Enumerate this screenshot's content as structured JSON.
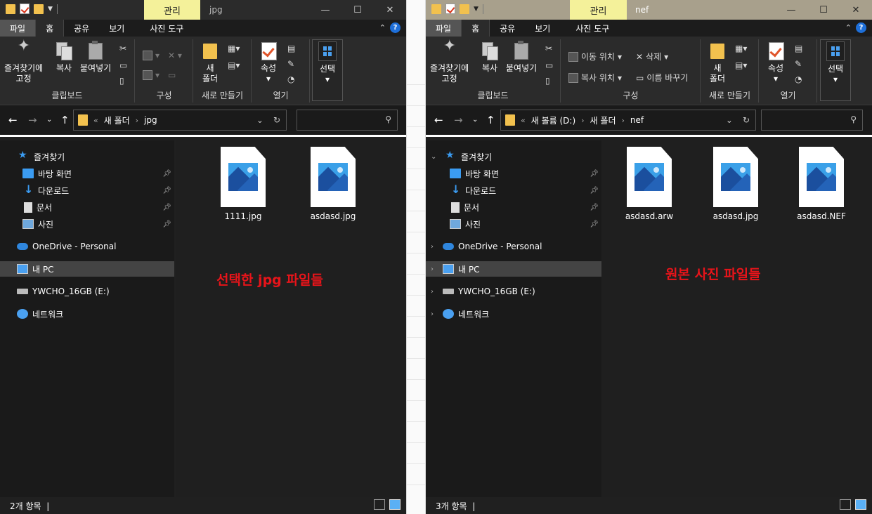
{
  "left": {
    "manage_tab": "관리",
    "title": "jpg",
    "ribbon_tabs": [
      "파일",
      "홈",
      "공유",
      "보기",
      "사진 도구"
    ],
    "ribbon": {
      "pin_label_1": "즐겨찾기에",
      "pin_label_2": "고정",
      "copy": "복사",
      "paste": "붙여넣기",
      "clipboard": "클립보드",
      "organize": "구성",
      "new_folder_1": "새",
      "new_folder_2": "폴더",
      "new_group": "새로 만들기",
      "properties": "속성",
      "open_group": "열기",
      "select": "선택"
    },
    "address": {
      "prefix": "«",
      "path": [
        "새 폴더",
        "jpg"
      ]
    },
    "nav": {
      "quick_access": "즐겨찾기",
      "desktop": "바탕 화면",
      "downloads": "다운로드",
      "documents": "문서",
      "pictures": "사진",
      "onedrive": "OneDrive - Personal",
      "this_pc": "내 PC",
      "usb": "YWCHO_16GB (E:)",
      "network": "네트워크"
    },
    "files": [
      "1111.jpg",
      "asdasd.jpg"
    ],
    "annotation": "선택한 jpg 파일들",
    "status": "2개 항목"
  },
  "right": {
    "manage_tab": "관리",
    "title": "nef",
    "ribbon_tabs": [
      "파일",
      "홈",
      "공유",
      "보기",
      "사진 도구"
    ],
    "ribbon": {
      "pin_label_1": "즐겨찾기에",
      "pin_label_2": "고정",
      "copy": "복사",
      "paste": "붙여넣기",
      "clipboard": "클립보드",
      "move_to": "이동 위치",
      "copy_to": "복사 위치",
      "delete": "삭제",
      "rename": "이름 바꾸기",
      "organize": "구성",
      "new_folder_1": "새",
      "new_folder_2": "폴더",
      "new_group": "새로 만들기",
      "properties": "속성",
      "open_group": "열기",
      "select": "선택"
    },
    "address": {
      "prefix": "«",
      "path": [
        "새 볼륨 (D:)",
        "새 폴더",
        "nef"
      ]
    },
    "nav": {
      "quick_access": "즐겨찾기",
      "desktop": "바탕 화면",
      "downloads": "다운로드",
      "documents": "문서",
      "pictures": "사진",
      "onedrive": "OneDrive - Personal",
      "this_pc": "내 PC",
      "usb": "YWCHO_16GB (E:)",
      "network": "네트워크"
    },
    "files": [
      "asdasd.arw",
      "asdasd.jpg",
      "asdasd.NEF"
    ],
    "annotation": "원본 사진 파일들",
    "status": "3개 항목"
  },
  "colors": {
    "annotation": "#e8141a",
    "manage_tab": "#f4f19a",
    "folder": "#f2c14e",
    "accent": "#3b9cf2"
  }
}
